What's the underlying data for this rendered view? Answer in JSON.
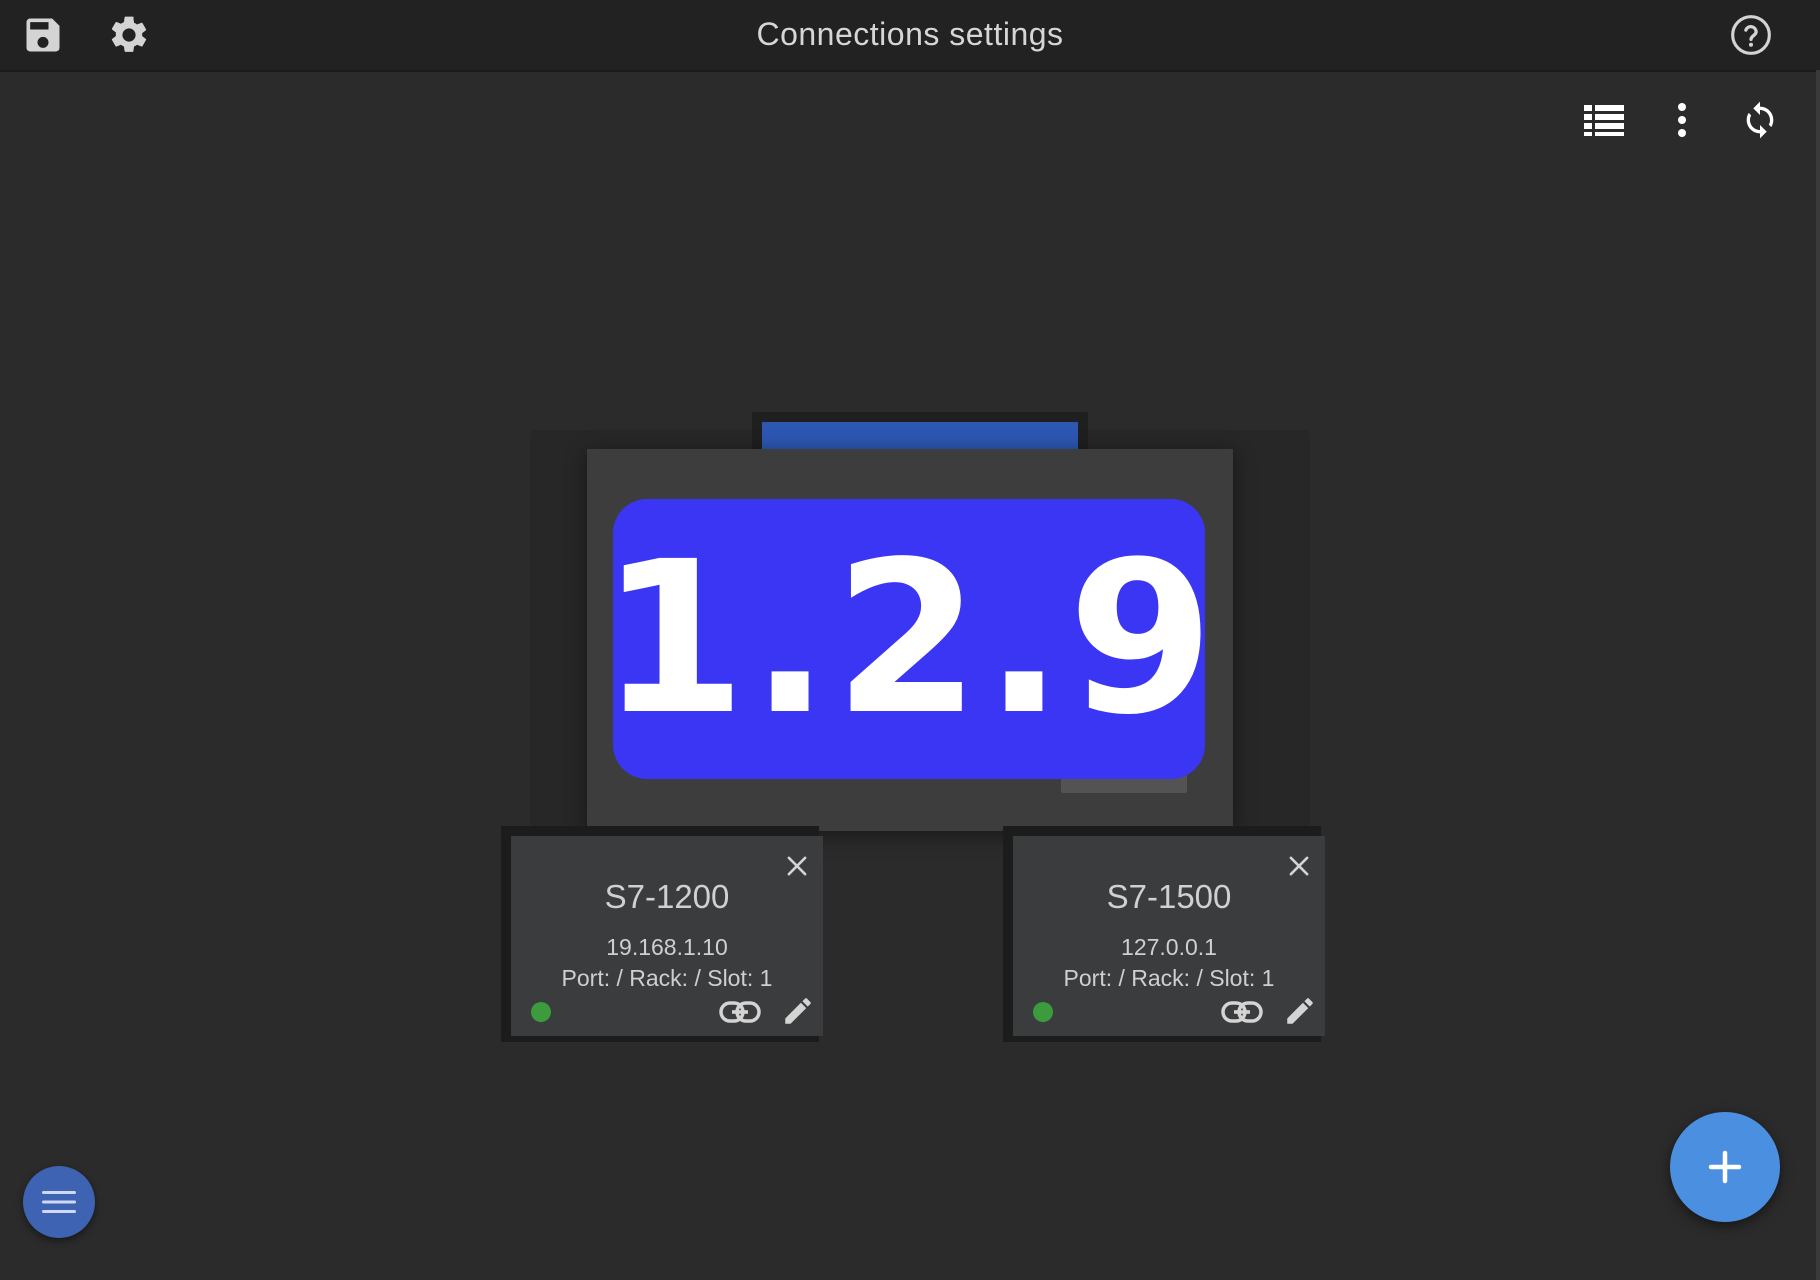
{
  "header": {
    "title": "Connections settings"
  },
  "center_node": {
    "version": "1.2.9"
  },
  "connections": [
    {
      "name": "S7-1200",
      "ip": "19.168.1.10",
      "detail": "Port: / Rack: / Slot: 1",
      "status": "connected"
    },
    {
      "name": "S7-1500",
      "ip": "127.0.0.1",
      "detail": "Port: / Rack: / Slot: 1",
      "status": "connected"
    }
  ],
  "colors": {
    "header_bg": "#222222",
    "canvas_bg": "#2b2b2b",
    "version_badge": "#3a36f4",
    "status_ok": "#3c9b3c",
    "fab": "#4a8fe0",
    "menu_fab": "#3e63b3"
  },
  "icons": {
    "save": "save-icon",
    "settings": "gear-icon",
    "help": "help-icon",
    "list_view": "list-view-icon",
    "more": "more-vert-icon",
    "refresh": "refresh-icon",
    "close": "close-icon",
    "link": "link-icon",
    "edit": "pencil-icon",
    "add": "plus-icon",
    "menu": "menu-icon"
  }
}
